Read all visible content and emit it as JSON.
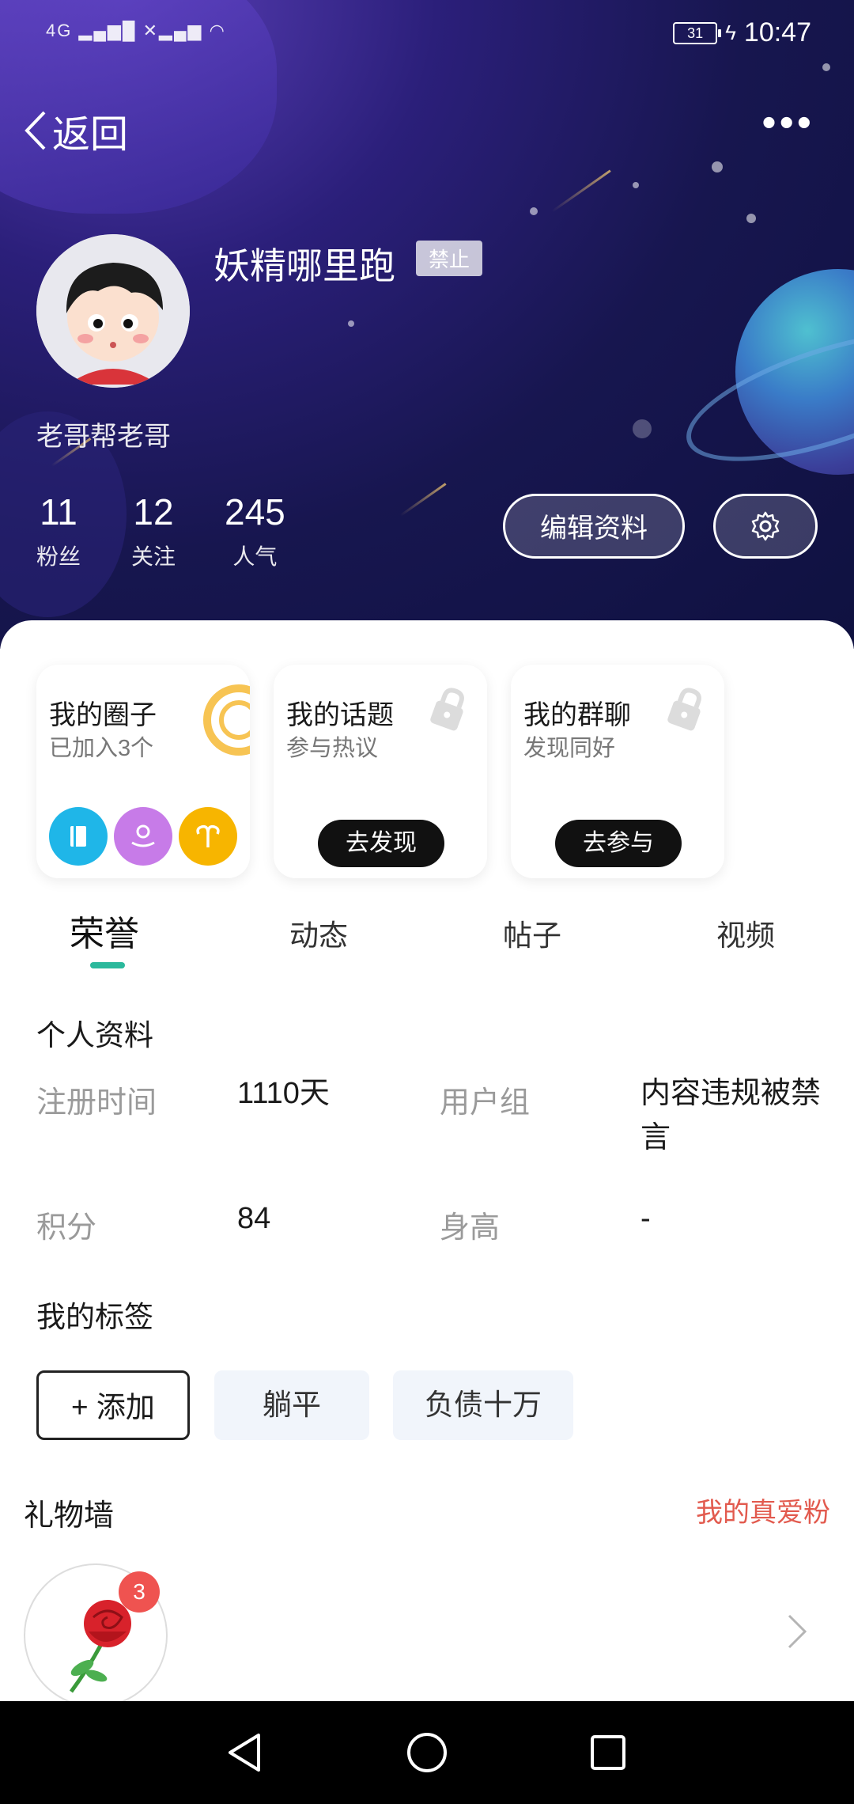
{
  "status_bar": {
    "signal_text": "4G",
    "battery": "31",
    "time": "10:47"
  },
  "header": {
    "back_label": "返回",
    "more_label": "•••"
  },
  "profile": {
    "username": "妖精哪里跑",
    "badge": "禁止",
    "signature": "老哥帮老哥",
    "stats": [
      {
        "num": "11",
        "label": "粉丝"
      },
      {
        "num": "12",
        "label": "关注"
      },
      {
        "num": "245",
        "label": "人气"
      }
    ],
    "edit_button": "编辑资料"
  },
  "cards": [
    {
      "title": "我的圈子",
      "subtitle": "已加入3个"
    },
    {
      "title": "我的话题",
      "subtitle": "参与热议",
      "button": "去发现"
    },
    {
      "title": "我的群聊",
      "subtitle": "发现同好",
      "button": "去参与"
    }
  ],
  "tabs": [
    "荣誉",
    "动态",
    "帖子",
    "视频"
  ],
  "personal": {
    "title": "个人资料",
    "reg_label": "注册时间",
    "reg_value": "1110天",
    "group_label": "用户组",
    "group_value": "内容违规被禁言",
    "points_label": "积分",
    "points_value": "84",
    "height_label": "身高",
    "height_value": "-"
  },
  "tags": {
    "title": "我的标签",
    "add_label": "+ 添加",
    "items": [
      "躺平",
      "负债十万"
    ]
  },
  "gifts": {
    "title": "礼物墙",
    "link": "我的真爱粉",
    "count": "3"
  },
  "colors": {
    "accent_tab": "#2bb99c",
    "link_red": "#e25a4e",
    "circle_icons": [
      "#1fb6e8",
      "#c77be8",
      "#f7b500"
    ]
  },
  "icons": {
    "circle_icons": [
      "book-icon",
      "person-hand-icon",
      "aries-icon"
    ]
  }
}
